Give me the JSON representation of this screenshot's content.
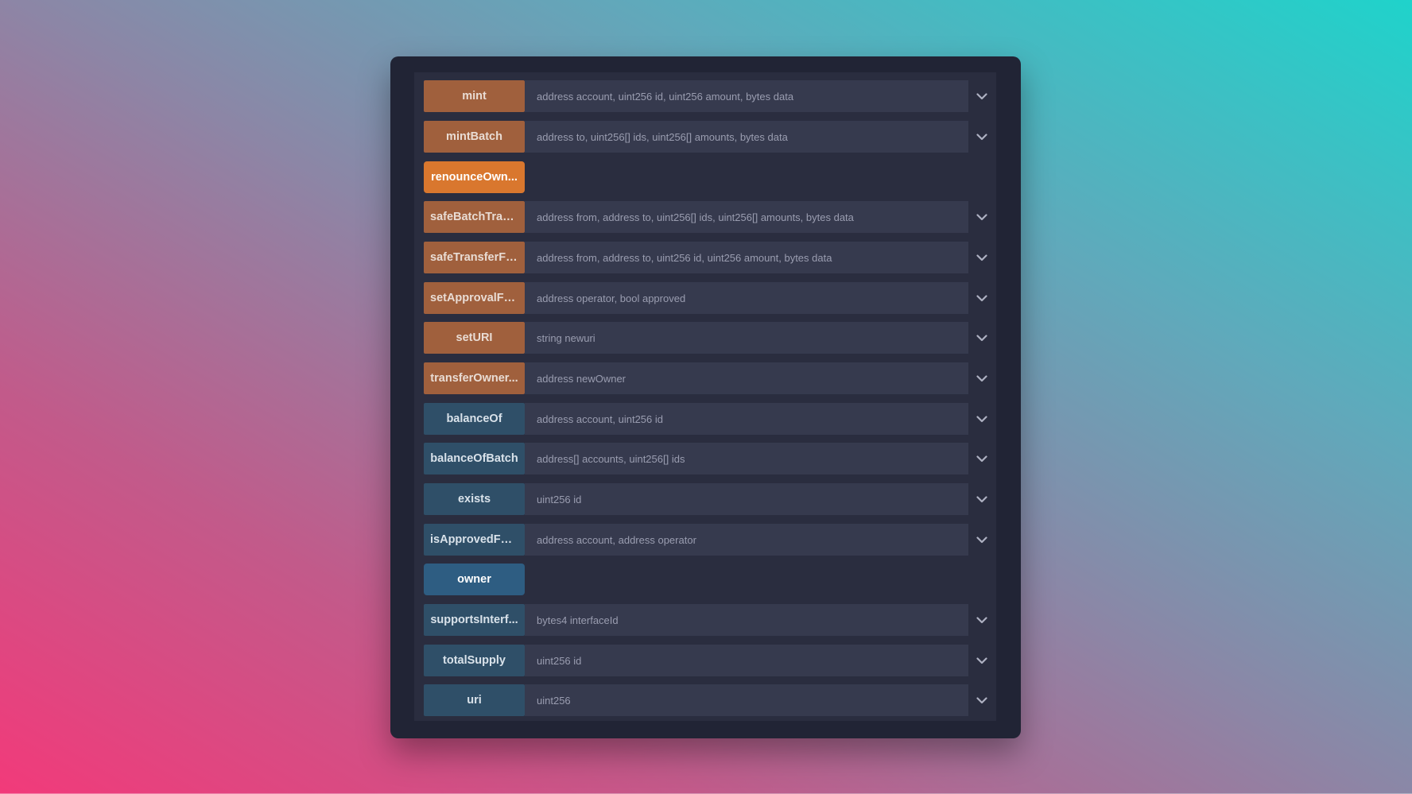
{
  "colors": {
    "write": "#a0603d",
    "write_noargs": "#d9772e",
    "read": "#2f4f68",
    "read_noargs": "#2e5d82",
    "input_bg": "#363a4e",
    "panel_bg": "#212435"
  },
  "functions": [
    {
      "label": "mint",
      "params": "address account, uint256 id, uint256 amount, bytes data",
      "kind": "write",
      "expand_icon": "chevron-down-icon"
    },
    {
      "label": "mintBatch",
      "params": "address to, uint256[] ids, uint256[] amounts, bytes data",
      "kind": "write",
      "expand_icon": "chevron-down-icon"
    },
    {
      "label": "renounceOwn...",
      "params": "",
      "kind": "write-noargs"
    },
    {
      "label": "safeBatchTran...",
      "params": "address from, address to, uint256[] ids, uint256[] amounts, bytes data",
      "kind": "write",
      "expand_icon": "chevron-down-icon"
    },
    {
      "label": "safeTransferFr...",
      "params": "address from, address to, uint256 id, uint256 amount, bytes data",
      "kind": "write",
      "expand_icon": "chevron-down-icon"
    },
    {
      "label": "setApprovalFo...",
      "params": "address operator, bool approved",
      "kind": "write",
      "expand_icon": "chevron-down-icon"
    },
    {
      "label": "setURI",
      "params": "string newuri",
      "kind": "write",
      "expand_icon": "chevron-down-icon"
    },
    {
      "label": "transferOwner...",
      "params": "address newOwner",
      "kind": "write",
      "expand_icon": "chevron-down-icon"
    },
    {
      "label": "balanceOf",
      "params": "address account, uint256 id",
      "kind": "read",
      "expand_icon": "chevron-down-icon"
    },
    {
      "label": "balanceOfBatch",
      "params": "address[] accounts, uint256[] ids",
      "kind": "read",
      "expand_icon": "chevron-down-icon"
    },
    {
      "label": "exists",
      "params": "uint256 id",
      "kind": "read",
      "expand_icon": "chevron-down-icon"
    },
    {
      "label": "isApprovedFor...",
      "params": "address account, address operator",
      "kind": "read",
      "expand_icon": "chevron-down-icon"
    },
    {
      "label": "owner",
      "params": "",
      "kind": "read-noargs"
    },
    {
      "label": "supportsInterf...",
      "params": "bytes4 interfaceId",
      "kind": "read",
      "expand_icon": "chevron-down-icon"
    },
    {
      "label": "totalSupply",
      "params": "uint256 id",
      "kind": "read",
      "expand_icon": "chevron-down-icon"
    },
    {
      "label": "uri",
      "params": "uint256",
      "kind": "read",
      "expand_icon": "chevron-down-icon"
    }
  ]
}
